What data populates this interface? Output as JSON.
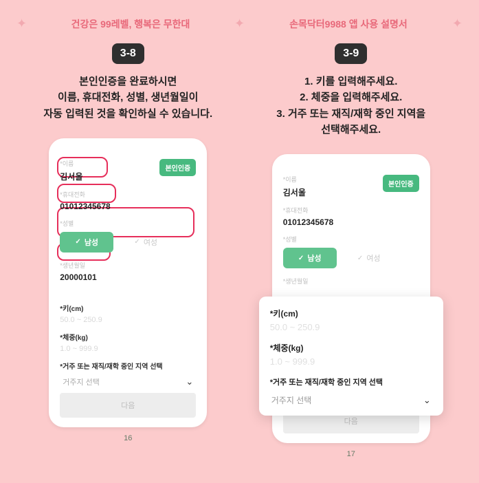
{
  "header": {
    "left_title": "건강은 99레벨, 행복은 무한대",
    "right_title": "손목닥터9988 앱 사용 설명서"
  },
  "left": {
    "step": "3-8",
    "instructions": [
      "본인인증을 완료하시면",
      "이름, 휴대전화, 성별, 생년월일이",
      "자동 입력된 것을 확인하실 수 있습니다."
    ],
    "phone": {
      "name_label": "*이름",
      "name_value": "김서울",
      "verify": "본인인증",
      "tel_label": "*휴대전화",
      "tel_value": "01012345678",
      "gender_label": "*성별",
      "gender_male": "남성",
      "gender_female": "여성",
      "dob_label": "*생년월일",
      "dob_value": "20000101",
      "height_label": "*키(cm)",
      "height_ph": "50.0 ~ 250.9",
      "weight_label": "*체중(kg)",
      "weight_ph": "1.0 ~ 999.9",
      "region_label": "*거주 또는 재직/재학 중인 지역 선택",
      "region_ph": "거주지 선택",
      "next": "다음"
    },
    "pagenum": "16"
  },
  "right": {
    "step": "3-9",
    "instructions": [
      "1. 키를 입력해주세요.",
      "2. 체중을 입력해주세요.",
      "3. 거주 또는 재직/재학 중인 지역을",
      "선택해주세요."
    ],
    "phone": {
      "name_label": "*이름",
      "name_value": "김서울",
      "verify": "본인인증",
      "tel_label": "*휴대전화",
      "tel_value": "01012345678",
      "gender_label": "*성별",
      "gender_male": "남성",
      "gender_female": "여성",
      "dob_label": "*생년월일",
      "next": "다음"
    },
    "panel": {
      "height_label": "*키(cm)",
      "height_ph": "50.0 ~ 250.9",
      "weight_label": "*체중(kg)",
      "weight_ph": "1.0 ~ 999.9",
      "region_label": "*거주 또는 재직/재학 중인 지역 선택",
      "region_ph": "거주지 선택"
    },
    "pagenum": "17"
  }
}
